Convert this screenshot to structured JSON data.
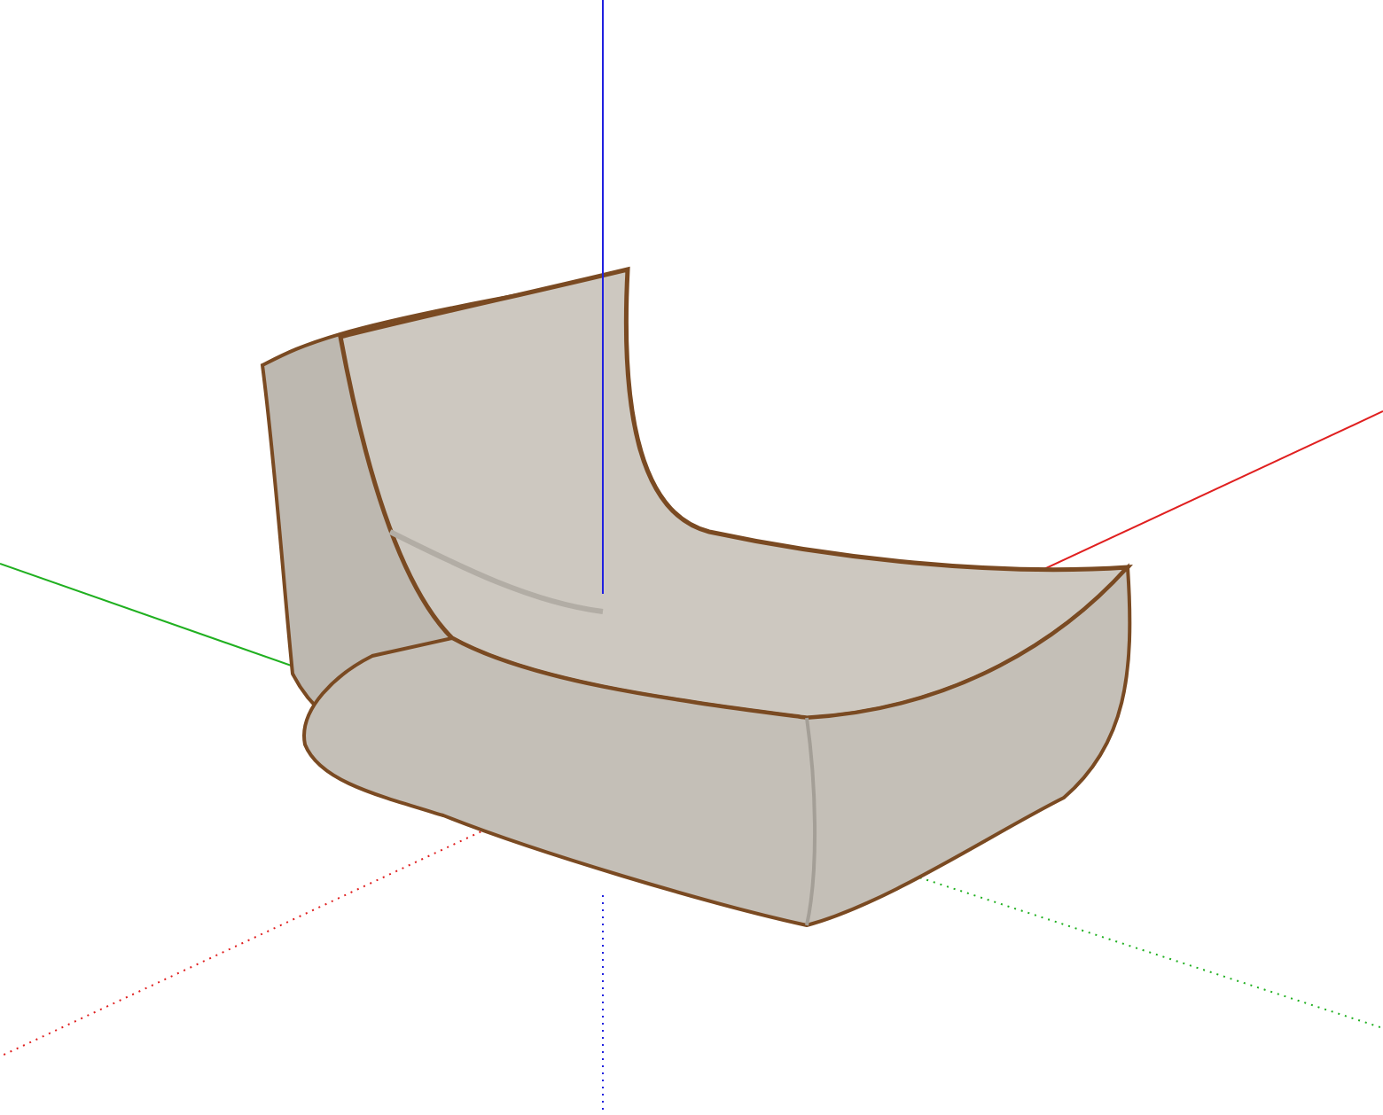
{
  "viewport": {
    "model": {
      "kind": "lounge-chair"
    },
    "axes": [
      {
        "kind": "red",
        "color": "#e02020"
      },
      {
        "kind": "green",
        "color": "#20b020"
      },
      {
        "kind": "blue",
        "color": "#2020e0"
      }
    ]
  }
}
